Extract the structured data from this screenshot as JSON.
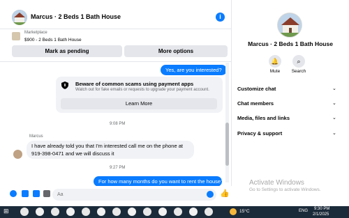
{
  "header": {
    "title": "Marcus · 2 Beds 1 Bath House"
  },
  "marketplace": {
    "label": "Marketplace",
    "item": "$900 - 2 Beds 1 Bath House",
    "mark_pending": "Mark as pending",
    "more_options": "More options"
  },
  "chat": {
    "msg_out_1": "Yes, are you interested?",
    "warning_title": "Beware of common scams using payment apps",
    "warning_sub": "Watch out for fake emails or requests to upgrade your payment account.",
    "learn_more": "Learn More",
    "time_1": "9:08 PM",
    "sender": "Marcus",
    "msg_in_1": "I have already told you that I'm interested call me on the phone at 919-398-0471 and we will discuss it",
    "time_2": "9:27 PM",
    "msg_out_2": "For how many months do you want to rent the house?"
  },
  "composer": {
    "placeholder": "Aa"
  },
  "profile": {
    "name": "Marcus · 2 Beds 1 Bath House",
    "mute": "Mute",
    "search": "Search",
    "sections": [
      "Customize chat",
      "Chat members",
      "Media, files and links",
      "Privacy & support"
    ]
  },
  "watermark": {
    "line1": "Activate Windows",
    "line2": "Go to Settings to activate Windows."
  },
  "taskbar": {
    "weather": "15°C",
    "lang": "ENG",
    "time": "9:30 PM",
    "date": "2/1/2025"
  },
  "colors": {
    "accent": "#0a7cff",
    "bubble_in": "#f0f2f5",
    "taskbar": "#1c2b3a"
  }
}
